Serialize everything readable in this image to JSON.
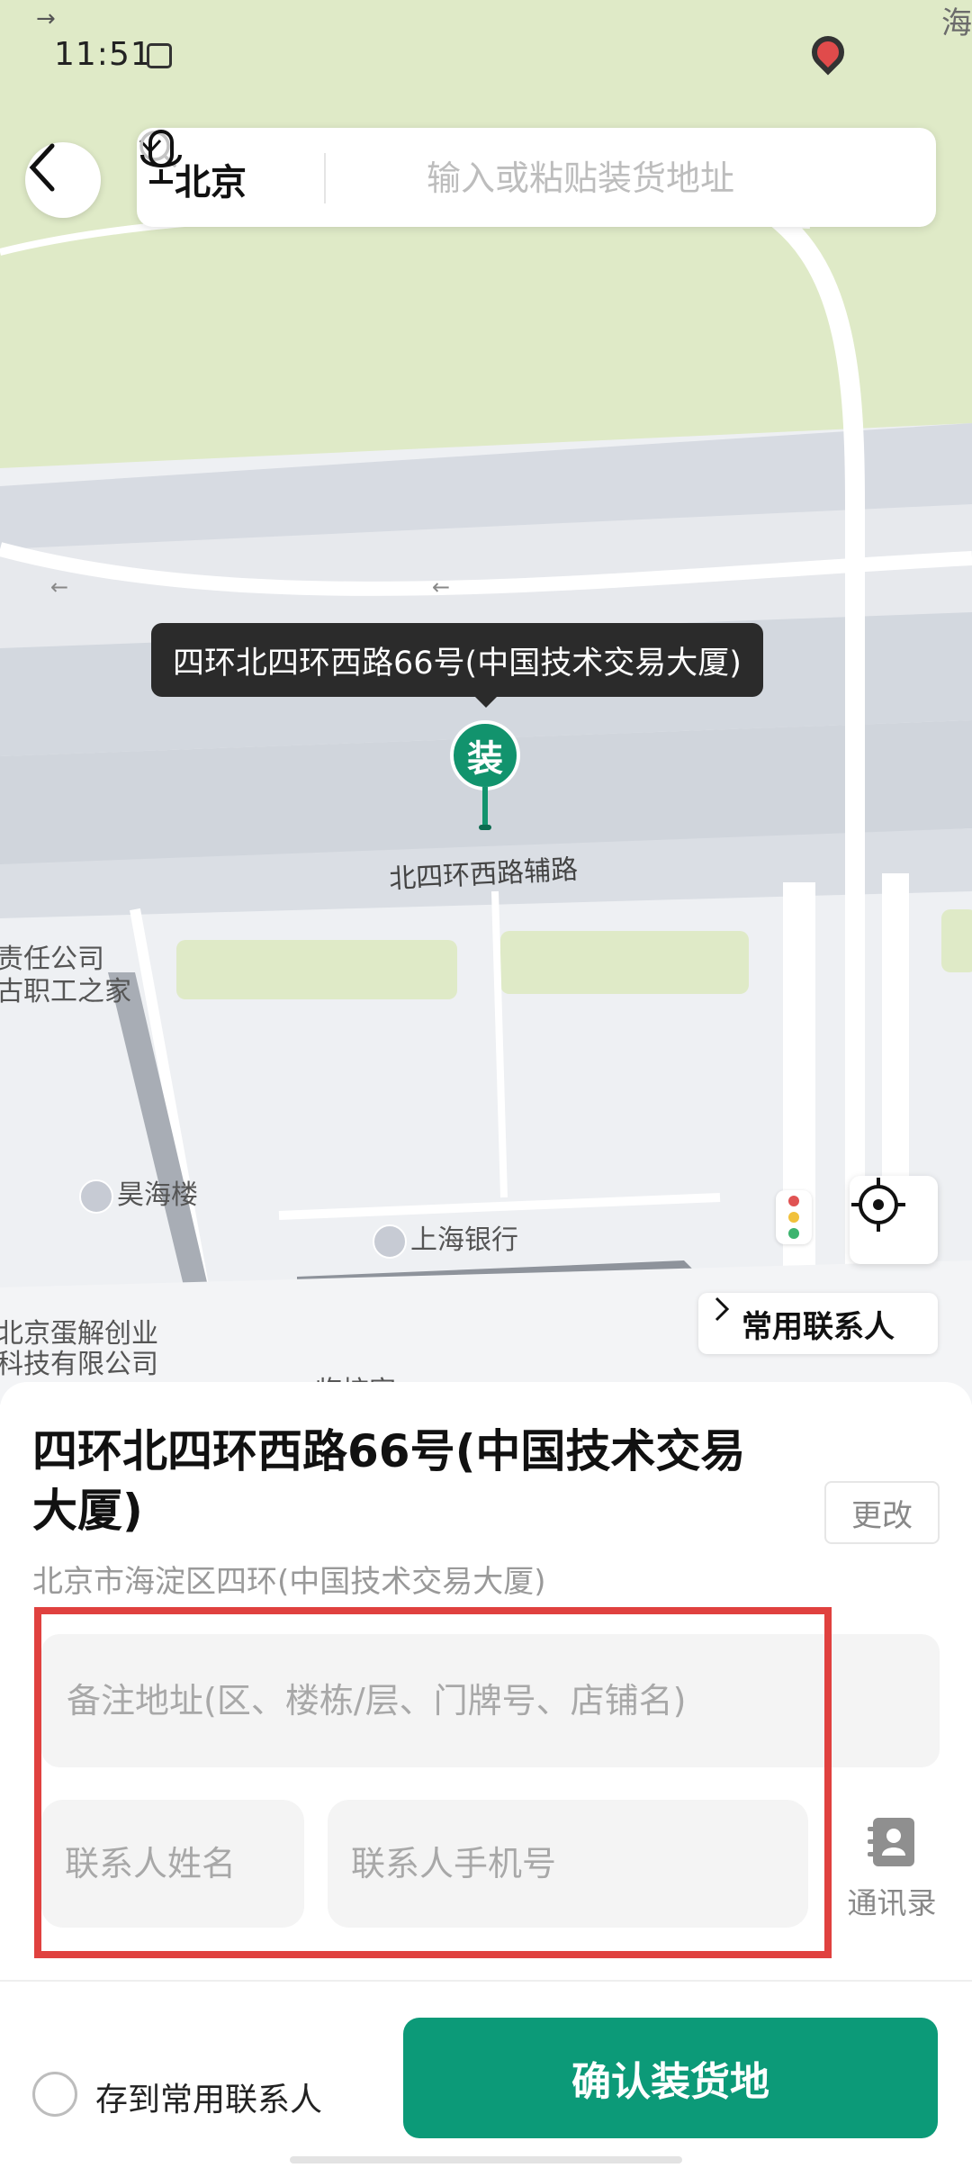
{
  "status_bar": {
    "time": "11:51",
    "corner_text": "海"
  },
  "search": {
    "city": "北京",
    "placeholder": "输入或粘贴装货地址"
  },
  "map": {
    "pin_tooltip": "四环北四环西路66号(中国技术交易大厦)",
    "pin_label": "装",
    "road_label": "北四环西路辅路",
    "labels": {
      "company_1": "责任公司",
      "company_2": "古职工之家",
      "poi_haohai": "昊海楼",
      "poi_bank": "上海银行",
      "company_3": "北京蛋解创业",
      "company_4": "科技有限公司",
      "partial": "临棕家"
    },
    "common_contacts": "常用联系人"
  },
  "sheet": {
    "title": "四环北四环西路66号(中国技术交易大厦)",
    "change_label": "更改",
    "subtitle": "北京市海淀区四环(中国技术交易大厦)",
    "remark_placeholder": "备注地址(区、楼栋/层、门牌号、店铺名)",
    "name_placeholder": "联系人姓名",
    "phone_placeholder": "联系人手机号",
    "addressbook_label": "通讯录",
    "save_label": "存到常用联系人",
    "confirm_label": "确认装货地"
  },
  "colors": {
    "accent": "#0c9a78",
    "highlight": "#e0413f",
    "map_green": "#dfeac7"
  }
}
